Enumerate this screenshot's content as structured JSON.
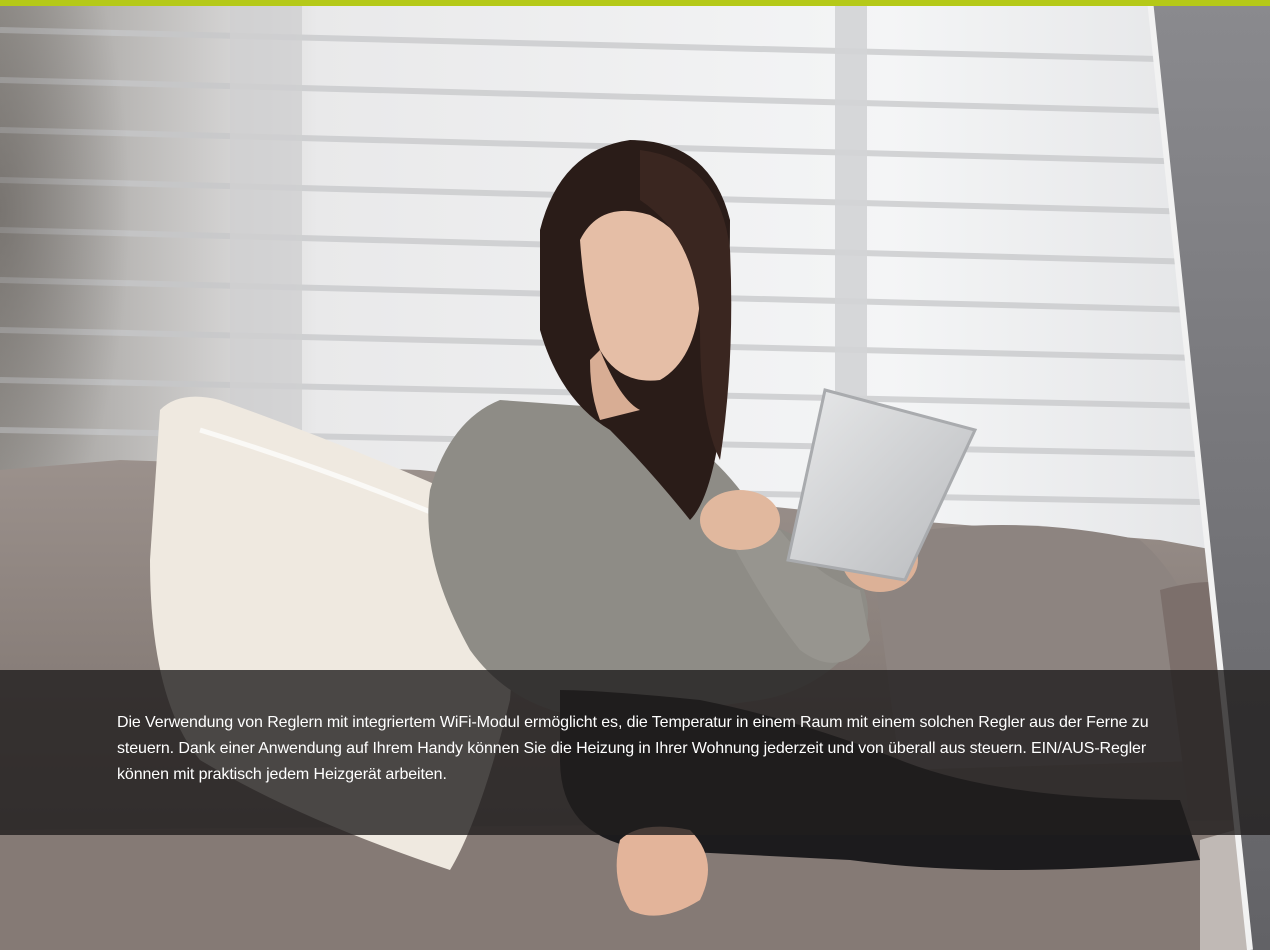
{
  "caption": {
    "text": "Die Verwendung von Reglern mit integriertem WiFi-Modul ermöglicht es, die Temperatur in einem Raum mit einem solchen Regler aus der Ferne zu steuern. Dank einer Anwendung auf Ihrem Handy können Sie die Heizung in Ihrer Wohnung jederzeit und von überall aus steuern. EIN/AUS-Regler können mit praktisch jedem Heizgerät arbeiten."
  },
  "colors": {
    "accent_bar": "#b5c918",
    "side_panel": "#77777b",
    "caption_background": "#201e1e"
  },
  "scene": {
    "subject": "woman-with-tablet-on-sofa"
  }
}
